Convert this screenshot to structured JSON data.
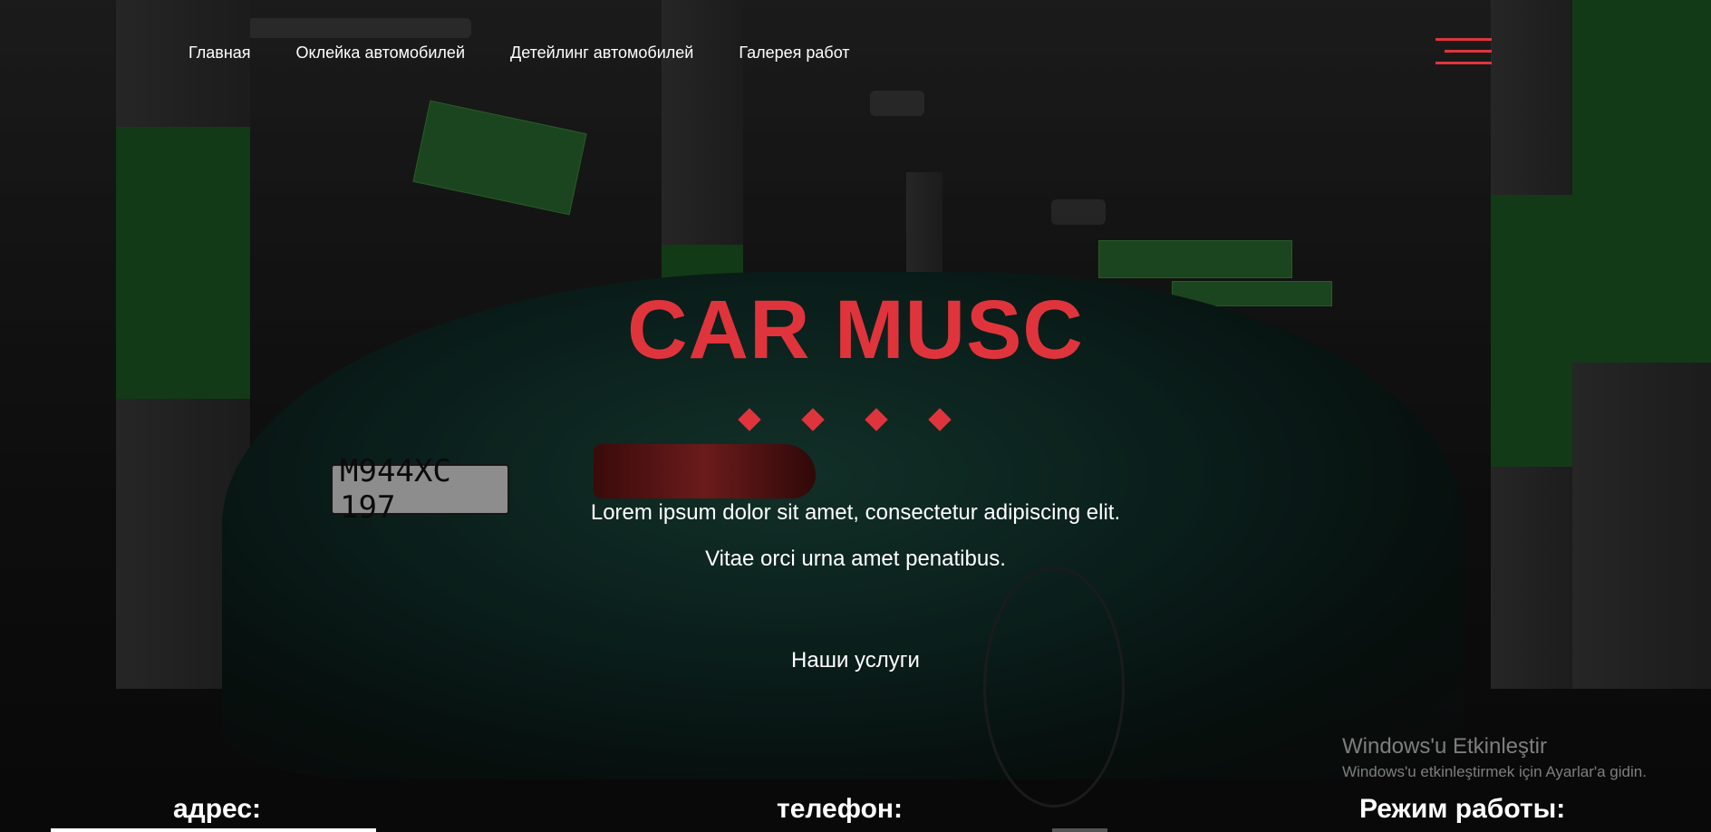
{
  "nav": {
    "items": [
      {
        "label": "Главная"
      },
      {
        "label": "Оклейка автомобилей"
      },
      {
        "label": "Детейлинг автомобилей"
      },
      {
        "label": "Галерея работ"
      }
    ]
  },
  "hero": {
    "title": "CAR MUSC",
    "line1": "Lorem ipsum dolor sit amet, consectetur adipiscing elit.",
    "line2": "Vitae orci urna amet penatibus.",
    "services_link": "Наши услуги"
  },
  "background": {
    "plate_text": "M944XC 197"
  },
  "footer": {
    "address_label": "адрес:",
    "phone_label": "телефон:",
    "hours_label": "Режим работы:"
  },
  "watermark": {
    "title": "Windows'u Etkinleştir",
    "subtitle": "Windows'u etkinleştirmek için Ayarlar'a gidin."
  },
  "colors": {
    "accent": "#e0343d",
    "text": "#ffffff"
  },
  "icons": {
    "menu": "hamburger-menu-icon"
  }
}
